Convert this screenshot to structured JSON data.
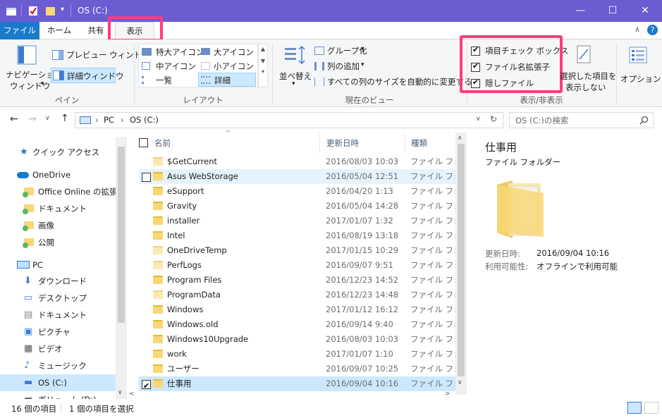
{
  "window": {
    "title": "OS (C:)"
  },
  "tabs": {
    "file": "ファイル",
    "home": "ホーム",
    "share": "共有",
    "view": "表示"
  },
  "ribbon": {
    "pane": {
      "nav_pane_line1": "ナビゲーション",
      "nav_pane_line2": "ウィンドウ",
      "preview_pane": "プレビュー ウィンドウ",
      "details_pane": "詳細ウィンドウ",
      "label": "ペイン"
    },
    "layout": {
      "extra_large": "特大アイコン",
      "large": "大アイコン",
      "medium": "中アイコン",
      "small": "小アイコン",
      "list": "一覧",
      "details": "詳細",
      "label": "レイアウト"
    },
    "current_view": {
      "sort": "並べ替え",
      "group_by": "グループ化",
      "add_columns": "列の追加",
      "size_all_columns": "すべての列のサイズを自動的に変更する",
      "label": "現在のビュー"
    },
    "show_hide": {
      "item_checkboxes": "項目チェック ボックス",
      "file_extensions": "ファイル名拡張子",
      "hidden_items": "隠しファイル",
      "hide_selected_line1": "選択した項目を",
      "hide_selected_line2": "表示しない",
      "label": "表示/非表示"
    },
    "options": "オプション"
  },
  "address": {
    "pc": "PC",
    "drive": "OS (C:)",
    "search_placeholder": "OS (C:)の検索"
  },
  "nav": {
    "quick_access": "クイック アクセス",
    "onedrive": "OneDrive",
    "onedrive_items": [
      "Office Online の拡張",
      "ドキュメント",
      "画像",
      "公開"
    ],
    "pc": "PC",
    "pc_items": [
      "ダウンロード",
      "デスクトップ",
      "ドキュメント",
      "ピクチャ",
      "ビデオ",
      "ミュージック",
      "OS (C:)",
      "ボリューム (D:)"
    ]
  },
  "columns": {
    "name": "名前",
    "date": "更新日時",
    "type": "種類"
  },
  "files": [
    {
      "name": "$GetCurrent",
      "date": "2016/08/03 10:03",
      "type": "ファイル フォルダー"
    },
    {
      "name": "Asus WebStorage",
      "date": "2016/05/04 12:51",
      "type": "ファイル フォルダー"
    },
    {
      "name": "eSupport",
      "date": "2016/04/20 1:13",
      "type": "ファイル フォルダー"
    },
    {
      "name": "Gravity",
      "date": "2016/05/04 14:28",
      "type": "ファイル フォルダー"
    },
    {
      "name": "installer",
      "date": "2017/01/07 1:32",
      "type": "ファイル フォルダー"
    },
    {
      "name": "Intel",
      "date": "2016/08/19 13:18",
      "type": "ファイル フォルダー"
    },
    {
      "name": "OneDriveTemp",
      "date": "2017/01/15 10:29",
      "type": "ファイル フォルダー"
    },
    {
      "name": "PerfLogs",
      "date": "2016/09/07 9:51",
      "type": "ファイル フォルダー"
    },
    {
      "name": "Program Files",
      "date": "2016/12/23 14:52",
      "type": "ファイル フォルダー"
    },
    {
      "name": "ProgramData",
      "date": "2016/12/23 14:48",
      "type": "ファイル フォルダー"
    },
    {
      "name": "Windows",
      "date": "2017/01/12 16:12",
      "type": "ファイル フォルダー"
    },
    {
      "name": "Windows.old",
      "date": "2016/09/14 9:40",
      "type": "ファイル フォルダー"
    },
    {
      "name": "Windows10Upgrade",
      "date": "2016/08/03 10:03",
      "type": "ファイル フォルダー"
    },
    {
      "name": "work",
      "date": "2017/01/07 1:10",
      "type": "ファイル フォルダー"
    },
    {
      "name": "ユーザー",
      "date": "2016/09/07 10:25",
      "type": "ファイル フォルダー"
    },
    {
      "name": "仕事用",
      "date": "2016/09/04 10:16",
      "type": "ファイル フォルダー"
    }
  ],
  "preview": {
    "name": "仕事用",
    "type": "ファイル フォルダー",
    "modified_label": "更新日時:",
    "modified_value": "2016/09/04 10:16",
    "availability_label": "利用可能性:",
    "availability_value": "オフラインで利用可能"
  },
  "status": {
    "item_count": "16 個の項目",
    "selected": "1 個の項目を選択"
  },
  "colors": {
    "titlebar": "#6b5cd2",
    "file_tab": "#1979ca",
    "highlight": "#ff3b7f",
    "selection": "#cce8ff",
    "folder": "#f8d775"
  }
}
